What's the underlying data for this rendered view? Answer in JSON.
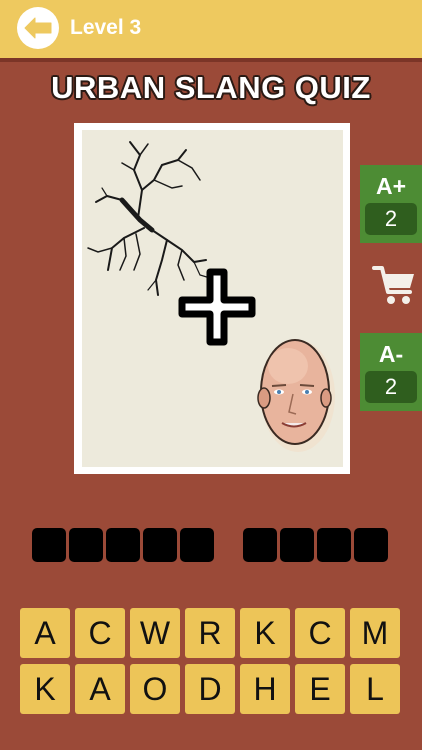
{
  "header": {
    "level_label": "Level 3",
    "back_icon": "arrow-left-icon",
    "colors": {
      "bar": "#eec95f",
      "background": "#9b4a38"
    }
  },
  "title": "URBAN SLANG QUIZ",
  "puzzle": {
    "images": [
      "cracked-surface",
      "plus-sign",
      "bald-head"
    ]
  },
  "hints": {
    "add_letter": {
      "label": "A+",
      "count": "2"
    },
    "remove_letter": {
      "label": "A-",
      "count": "2"
    },
    "cart_icon": "shopping-cart-icon"
  },
  "answer": {
    "word_lengths": [
      5,
      4
    ]
  },
  "keyboard": {
    "row1": [
      "A",
      "C",
      "W",
      "R",
      "K",
      "C",
      "M"
    ],
    "row2": [
      "K",
      "A",
      "O",
      "D",
      "H",
      "E",
      "L"
    ]
  }
}
